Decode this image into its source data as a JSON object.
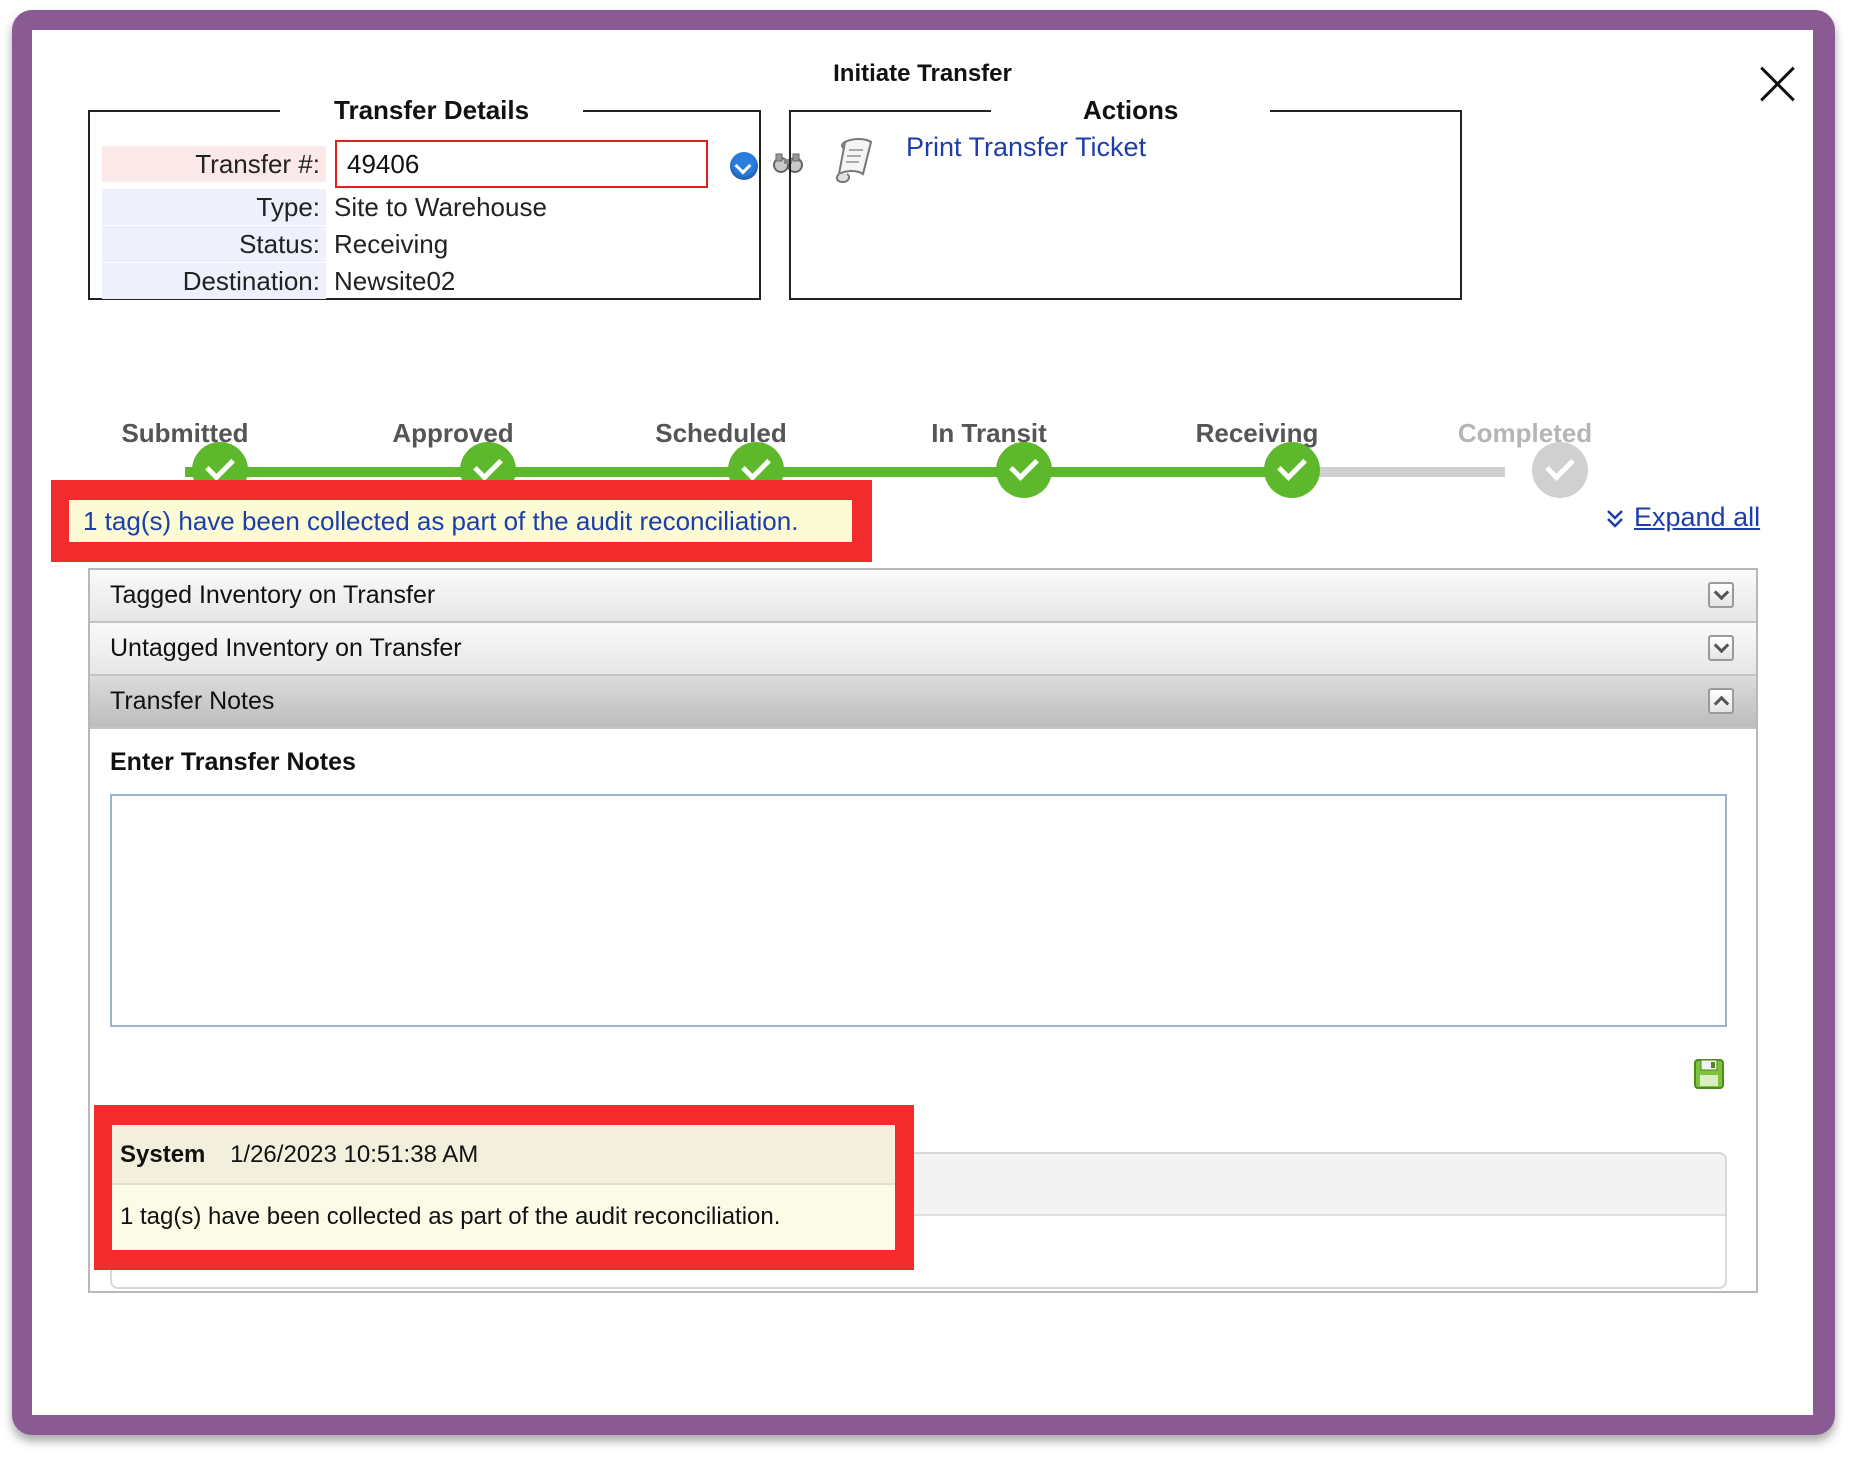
{
  "dialog": {
    "title": "Initiate Transfer"
  },
  "transfer_details": {
    "legend": "Transfer Details",
    "transfer_label": "Transfer #:",
    "transfer_value": "49406",
    "type_label": "Type:",
    "type_value": "Site to Warehouse",
    "status_label": "Status:",
    "status_value": "Receiving",
    "destination_label": "Destination:",
    "destination_value": "Newsite02"
  },
  "actions": {
    "legend": "Actions",
    "print_label": "Print Transfer Ticket"
  },
  "progress": {
    "steps": [
      {
        "label": "Submitted",
        "complete": true
      },
      {
        "label": "Approved",
        "complete": true
      },
      {
        "label": "Scheduled",
        "complete": true
      },
      {
        "label": "In Transit",
        "complete": true
      },
      {
        "label": "Receiving",
        "complete": true
      },
      {
        "label": "Completed",
        "complete": false
      }
    ],
    "active_color": "#5eb82c",
    "inactive_color": "#d0d0d0"
  },
  "message": {
    "text": "1 tag(s) have been collected as part of the audit reconciliation."
  },
  "expand_all_label": "Expand all",
  "sections": [
    {
      "title": "Tagged Inventory on Transfer",
      "expanded": false
    },
    {
      "title": "Untagged Inventory on Transfer",
      "expanded": false
    },
    {
      "title": "Transfer Notes",
      "expanded": true
    }
  ],
  "notes": {
    "label": "Enter Transfer Notes",
    "input_value": "",
    "entries": [
      {
        "user": "System",
        "timestamp": "1/26/2023 10:51:38 AM",
        "text": "1 tag(s) have been collected as part of the audit reconciliation."
      }
    ]
  },
  "colors": {
    "frame": "#8a5a92",
    "highlight": "#f22c2c",
    "link": "#1d3ea8"
  }
}
